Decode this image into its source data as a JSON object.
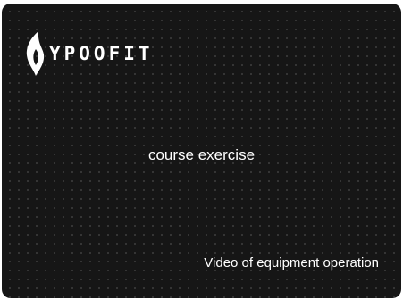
{
  "brand": {
    "name": "YPOOFIT",
    "logo_icon": "flame-logo-icon"
  },
  "main": {
    "title": "course exercise",
    "link_label": "Video of equipment operation"
  },
  "colors": {
    "background": "#161616",
    "text": "#ffffff"
  }
}
